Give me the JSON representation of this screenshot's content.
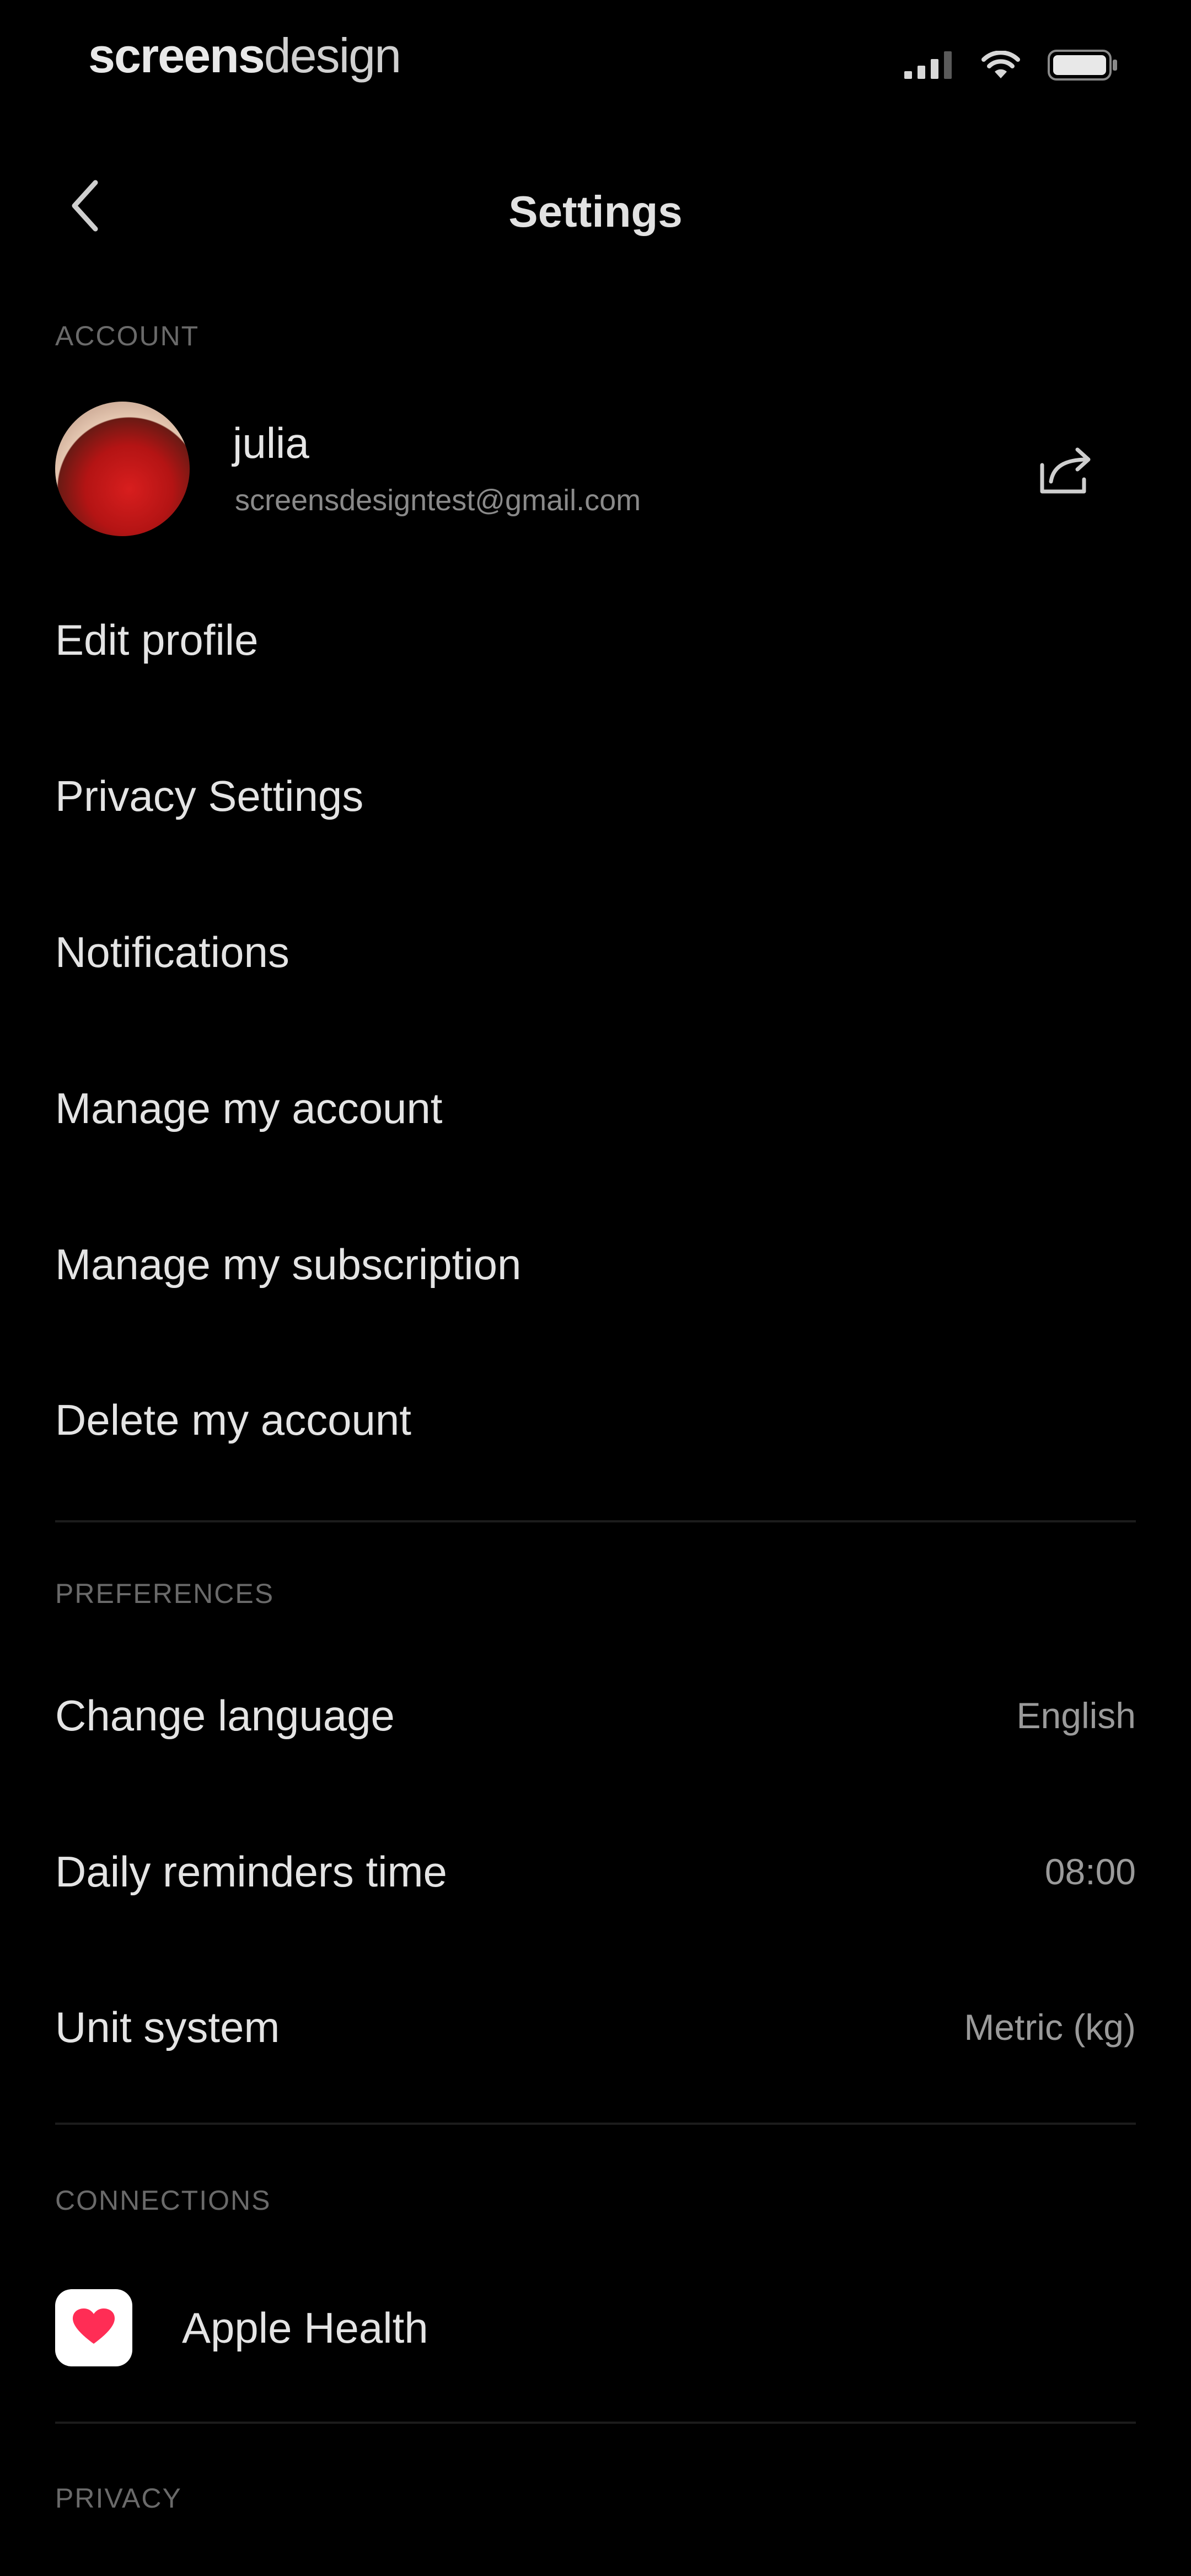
{
  "status_bar": {
    "brand_bold": "screens",
    "brand_light": "design",
    "icons": [
      "cellular-signal-icon",
      "wifi-icon",
      "battery-icon"
    ]
  },
  "header": {
    "title": "Settings",
    "back_icon": "chevron-left-icon"
  },
  "account": {
    "section_label": "ACCOUNT",
    "profile": {
      "name": "julia",
      "email": "screensdesigntest@gmail.com",
      "share_icon": "share-icon"
    },
    "items": [
      {
        "label": "Edit profile"
      },
      {
        "label": "Privacy Settings"
      },
      {
        "label": "Notifications"
      },
      {
        "label": "Manage my account"
      },
      {
        "label": "Manage my subscription"
      },
      {
        "label": "Delete my account"
      }
    ]
  },
  "preferences": {
    "section_label": "PREFERENCES",
    "items": [
      {
        "label": "Change language",
        "value": "English"
      },
      {
        "label": "Daily reminders time",
        "value": "08:00"
      },
      {
        "label": "Unit system",
        "value": "Metric (kg)"
      }
    ]
  },
  "connections": {
    "section_label": "CONNECTIONS",
    "items": [
      {
        "label": "Apple Health",
        "icon": "apple-health-heart-icon"
      }
    ]
  },
  "privacy": {
    "section_label": "PRIVACY"
  },
  "colors": {
    "background": "#000000",
    "text_primary": "#e4e4e4",
    "text_secondary": "#9a9a9a",
    "section_label": "#6a6a6a",
    "divider": "#1c1c1c",
    "health_heart": "#ff2d55"
  }
}
